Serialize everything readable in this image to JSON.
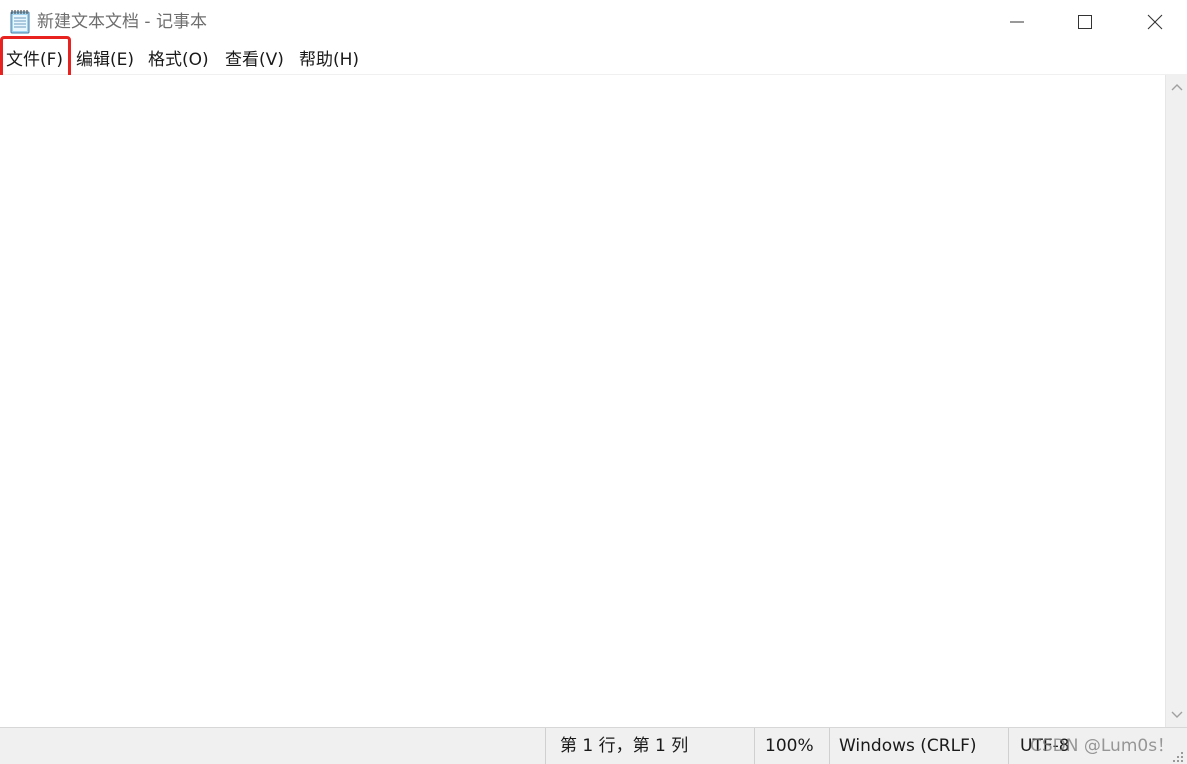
{
  "window": {
    "title": "新建文本文档 - 记事本"
  },
  "titlebar": {
    "app_icon": "notepad-icon",
    "minimize_icon": "minimize-icon",
    "maximize_icon": "maximize-icon",
    "close_icon": "close-icon"
  },
  "menu": {
    "items": [
      {
        "label": "文件(F)"
      },
      {
        "label": "编辑(E)"
      },
      {
        "label": "格式(O)"
      },
      {
        "label": "查看(V)"
      },
      {
        "label": "帮助(H)"
      }
    ],
    "highlighted": "文件(F)",
    "highlight_color": "#e8231f"
  },
  "editor": {
    "content": ""
  },
  "statusbar": {
    "position": "第 1 行，第 1 列",
    "zoom": "100%",
    "line_ending": "Windows (CRLF)",
    "encoding": "UTF-8"
  },
  "watermark": {
    "text": "CSDN @Lum0s！"
  }
}
